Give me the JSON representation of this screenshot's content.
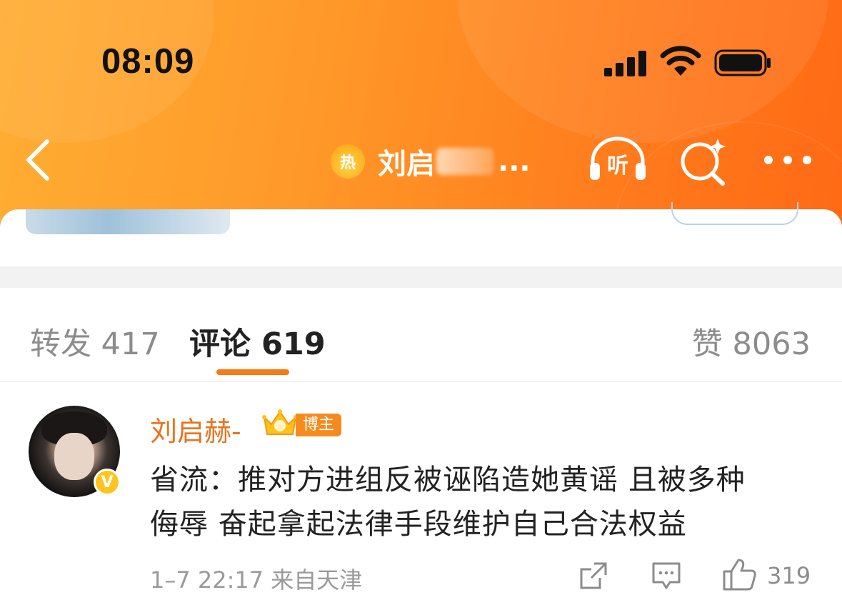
{
  "status_bar": {
    "time": "08:09"
  },
  "nav": {
    "hot_badge": "热",
    "title_visible": "刘启",
    "title_ellipsis": "...",
    "listen_label": "听"
  },
  "tabs": {
    "repost": "转发 417",
    "comment": "评论 619",
    "like": "赞 8063"
  },
  "comment": {
    "username": "刘启赫-",
    "author_tag": "博主",
    "verified_mark": "V",
    "text_line1": "省流：推对方进组反被诬陷造她黄谣 且被多种",
    "text_line2": "侮辱 奋起拿起法律手段维护自己合法权益",
    "meta": "1–7 22:17 来自天津",
    "likes": "319"
  },
  "colors": {
    "accent": "#f47b16",
    "username": "#e9731c",
    "header_gradient_start": "#ffae33",
    "header_gradient_end": "#ff6a14"
  }
}
